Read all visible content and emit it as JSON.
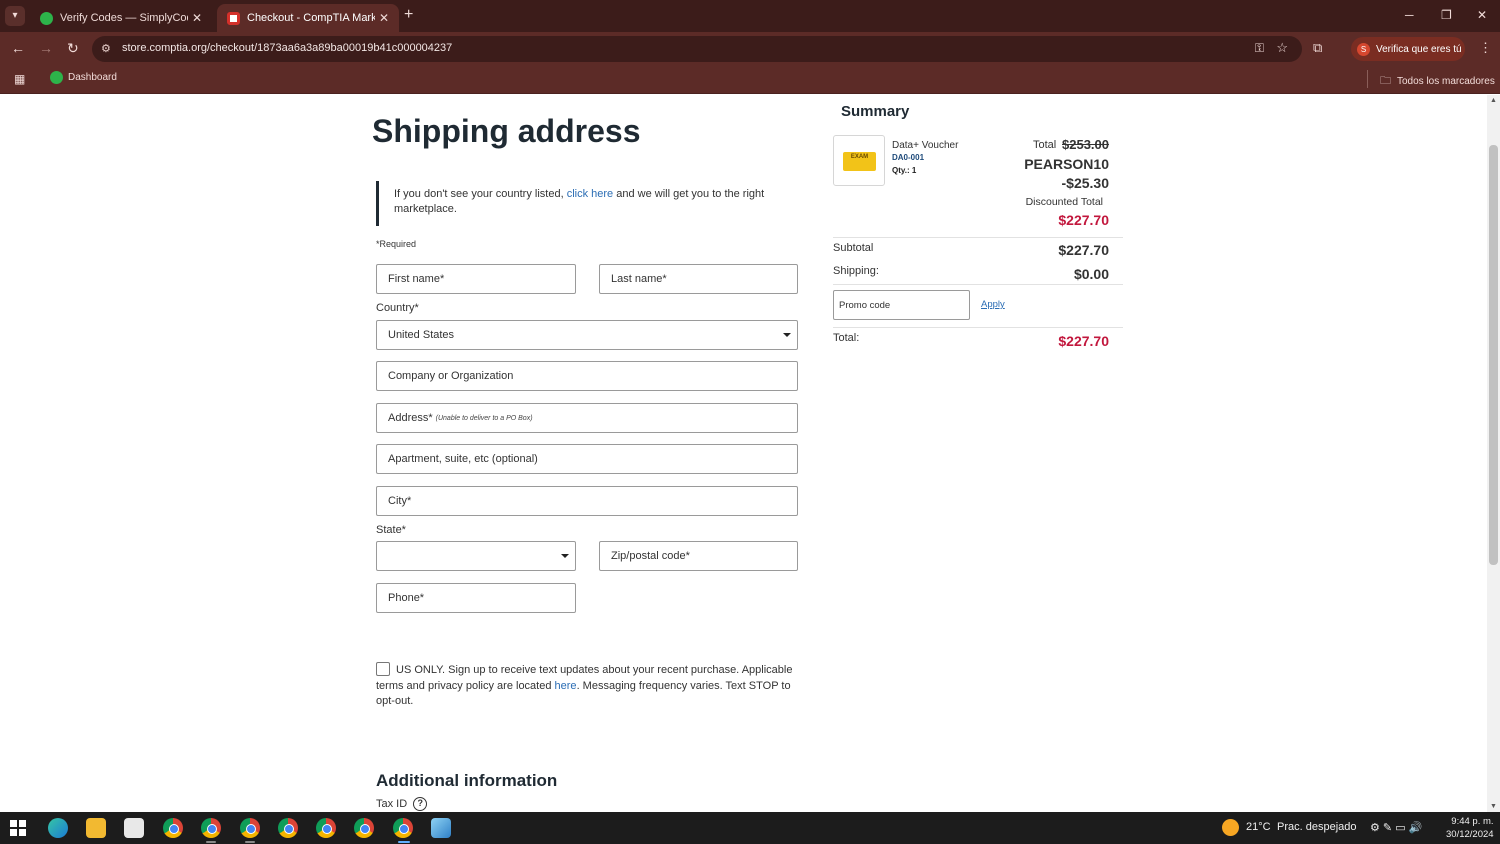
{
  "browser": {
    "tabs": [
      {
        "title": "Verify Codes — SimplyCodes",
        "active": false
      },
      {
        "title": "Checkout - CompTIA Marketplace",
        "active": true
      }
    ],
    "url": "store.comptia.org/checkout/1873aa6a3a89ba00019b41c000004237",
    "profile_label": "Verifica que eres tú",
    "profile_initial": "S",
    "bookmarks": [
      {
        "label": "Dashboard"
      }
    ],
    "all_bookmarks_label": "Todos los marcadores"
  },
  "shipping": {
    "heading": "Shipping address",
    "notice_before": "If you don't see your country listed, ",
    "notice_link": "click here",
    "notice_after": " and we will get you to the right marketplace.",
    "required_note": "*Required",
    "first_name": "First name*",
    "last_name": "Last name*",
    "country_label": "Country*",
    "country_value": "United States",
    "company": "Company or Organization",
    "address": "Address*",
    "address_hint": "(Unable to deliver to a PO Box)",
    "apartment": "Apartment, suite, etc (optional)",
    "city": "City*",
    "state_label": "State*",
    "state_value": "",
    "zip": "Zip/postal code*",
    "phone": "Phone*",
    "sms_text_before": "US ONLY. Sign up to receive text updates about your recent purchase. Applicable terms and privacy policy are located ",
    "sms_link": "here",
    "sms_text_after": ". Messaging frequency varies. Text STOP to opt-out.",
    "additional_heading": "Additional information",
    "tax_id_label": "Tax ID"
  },
  "summary": {
    "title": "Summary",
    "product_name": "Data+ Voucher",
    "product_sku": "DA0-001",
    "product_qty": "Qty.: 1",
    "product_image_text": "EXAM",
    "total_label": "Total",
    "total_original": "$253.00",
    "promo_code_applied": "PEARSON10",
    "promo_discount": "-$25.30",
    "discounted_total_label": "Discounted Total",
    "discounted_total": "$227.70",
    "subtotal_label": "Subtotal",
    "subtotal": "$227.70",
    "shipping_label": "Shipping:",
    "shipping": "$0.00",
    "promo_placeholder": "Promo code",
    "apply_label": "Apply",
    "grand_total_label": "Total:",
    "grand_total": "$227.70"
  },
  "taskbar": {
    "weather_temp": "21°C",
    "weather_desc": "Prac. despejado",
    "time": "9:44 p. m.",
    "date": "30/12/2024"
  },
  "colors": {
    "chrome_dark": "#3c1c1a",
    "chrome_mid": "#5c2b27",
    "price_red": "#c2173d",
    "link_blue": "#2b6db4",
    "heading": "#1f2a33"
  }
}
